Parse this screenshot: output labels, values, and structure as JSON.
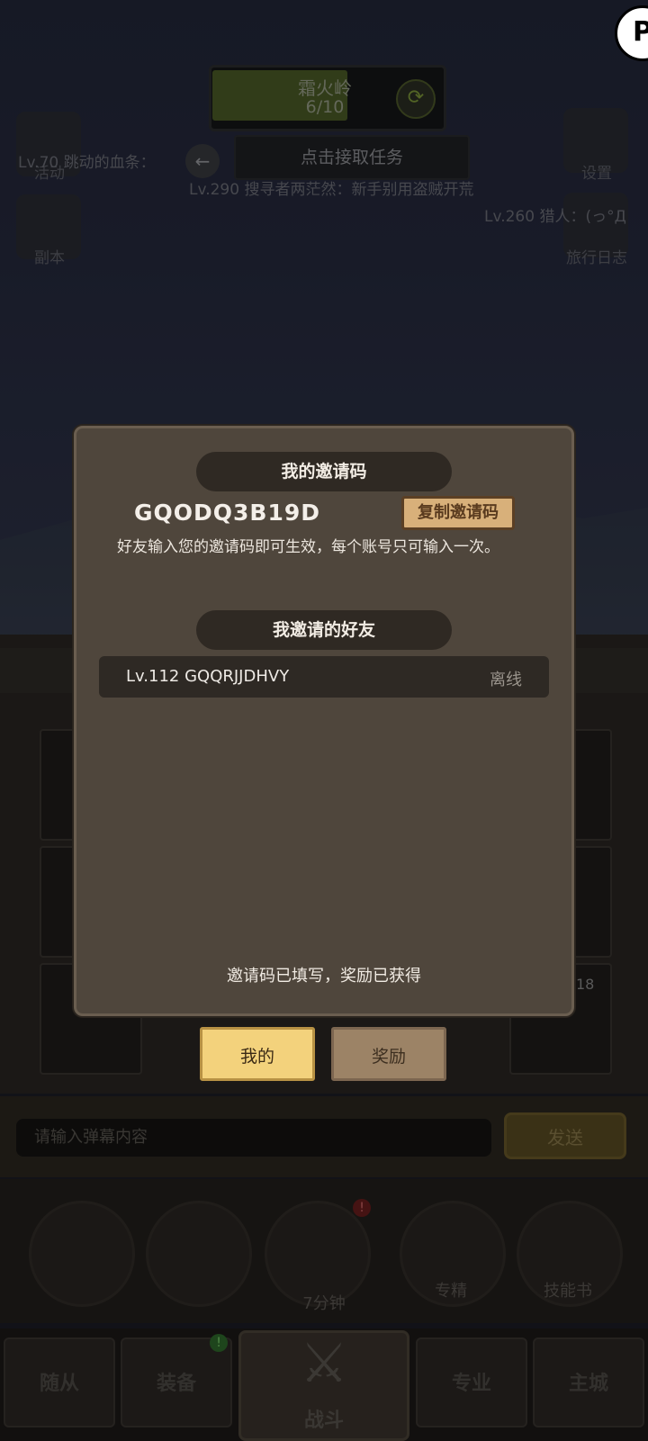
{
  "hud": {
    "region_name": "霜火岭",
    "region_progress": "6/10",
    "quest_button": "点击接取任务",
    "left_icons": [
      {
        "label": "活动",
        "icon": "event-scroll-icon"
      },
      {
        "label": "副本",
        "icon": "dungeon-crystal-icon"
      }
    ],
    "right_icons": [
      {
        "label": "设置",
        "icon": "gear-icon"
      },
      {
        "label": "旅行日志",
        "icon": "journal-book-icon"
      }
    ]
  },
  "chat_messages": [
    "Lv.70 跳动的血条：",
    "Lv.290 搜寻者两茫然：新手别用盗贼开荒",
    "Lv.260 猎人：(っ°Д"
  ],
  "inventory_badge": "18",
  "chat_input": {
    "placeholder": "请输入弹幕内容",
    "send_label": "发送"
  },
  "skills": [
    {
      "label": "",
      "icon": "potion-icon"
    },
    {
      "label": "",
      "icon": "bread-icon"
    },
    {
      "label": "7分钟",
      "icon": "treasure-chest-icon"
    },
    {
      "label": "专精",
      "icon": "specialization-icon"
    },
    {
      "label": "技能书",
      "icon": "skill-book-icon"
    }
  ],
  "bottom_nav": [
    {
      "label": "随从"
    },
    {
      "label": "装备"
    },
    {
      "label": "战斗"
    },
    {
      "label": "专业"
    },
    {
      "label": "主城"
    }
  ],
  "dialog": {
    "my_code_title": "我的邀请码",
    "invite_code": "GQODQ3B19D",
    "copy_button": "复制邀请码",
    "description": "好友输入您的邀请码即可生效，每个账号只可输入一次。",
    "friends_title": "我邀请的好友",
    "friends": [
      {
        "name": "Lv.112 GQQRJJDHVY",
        "status": "离线"
      }
    ],
    "filled_message": "邀请码已填写，奖励已获得",
    "tabs": [
      {
        "label": "我的",
        "active": true
      },
      {
        "label": "奖励",
        "active": false
      }
    ]
  },
  "corner_badge": "P"
}
